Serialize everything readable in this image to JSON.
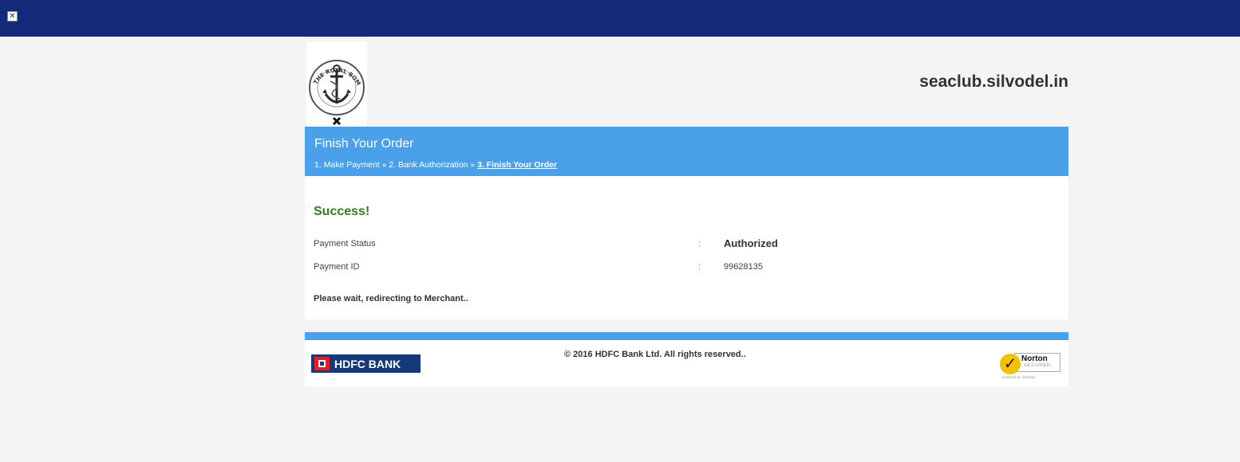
{
  "site": {
    "name": "seaclub.silvodel.in"
  },
  "logo": {
    "text": "THE ROYAL BOMBAY SEAMENS SOCIETY"
  },
  "top_icon": "broken-image-icon",
  "banner": {
    "title": "Finish Your Order",
    "steps": [
      "1. Make Payment",
      "2. Bank Authorization",
      "3. Finish Your Order"
    ],
    "separator": "»"
  },
  "result": {
    "heading": "Success!",
    "rows": [
      {
        "label": "Payment Status",
        "colon": ":",
        "value": "Authorized"
      },
      {
        "label": "Payment ID",
        "colon": ":",
        "value": "99628135"
      }
    ],
    "redirect": "Please wait, redirecting to Merchant.."
  },
  "footer": {
    "bank": "HDFC BANK",
    "copyright": "© 2016 HDFC Bank Ltd. All rights reserved..",
    "norton": {
      "name": "Norton",
      "sub": "SECURED",
      "powered": "powered by VeriSign"
    }
  },
  "colors": {
    "topbar": "#142a78",
    "accent": "#4ba1e9",
    "success": "#2d7f20",
    "hdfc_blue": "#15397a",
    "hdfc_red": "#e31e24"
  }
}
